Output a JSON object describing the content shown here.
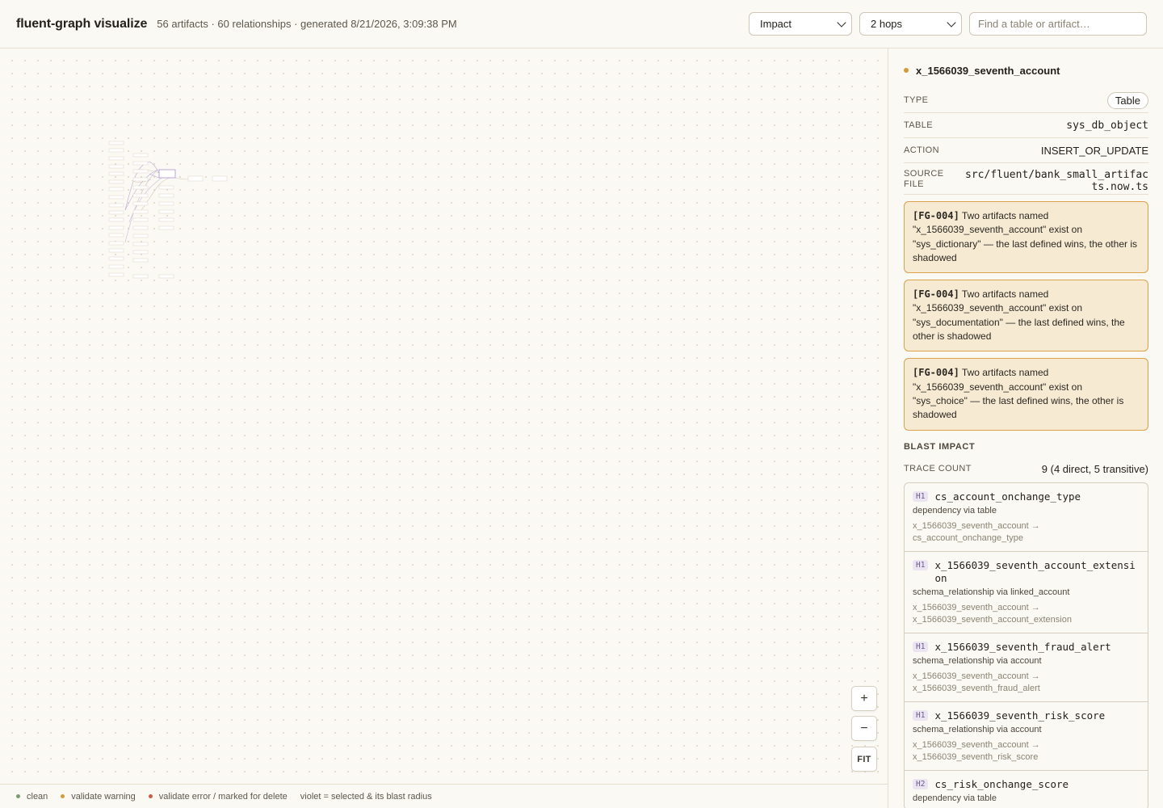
{
  "header": {
    "title": "fluent-graph visualize",
    "meta": "56 artifacts · 60 relationships · generated 8/21/2026, 3:09:38 PM",
    "view_select": "Impact",
    "hops_select": "2 hops",
    "search_placeholder": "Find a table or artifact…"
  },
  "canvas": {
    "zoom_in": "+",
    "zoom_out": "−",
    "fit": "FIT"
  },
  "legend": {
    "items": [
      {
        "label": "clean",
        "color": "#7d9b73"
      },
      {
        "label": "validate warning",
        "color": "#d39a3a"
      },
      {
        "label": "validate error / marked for delete",
        "color": "#d05a48"
      }
    ],
    "note": "violet = selected & its blast radius"
  },
  "panel": {
    "title": "x_1566039_seventh_account",
    "status_color": "#d39a3a",
    "props": {
      "type_label": "TYPE",
      "type_value": "Table",
      "table_label": "TABLE",
      "table_value": "sys_db_object",
      "action_label": "ACTION",
      "action_value": "INSERT_OR_UPDATE",
      "source_label": "SOURCE FILE",
      "source_value": "src/fluent/bank_small_artifacts.now.ts"
    },
    "warnings": [
      {
        "code": "[FG-004]",
        "text": " Two artifacts named \"x_1566039_seventh_account\" exist on \"sys_dictionary\" — the last defined wins, the other is shadowed"
      },
      {
        "code": "[FG-004]",
        "text": " Two artifacts named \"x_1566039_seventh_account\" exist on \"sys_documentation\" — the last defined wins, the other is shadowed"
      },
      {
        "code": "[FG-004]",
        "text": " Two artifacts named \"x_1566039_seventh_account\" exist on \"sys_choice\" — the last defined wins, the other is shadowed"
      }
    ],
    "blast_heading": "BLAST IMPACT",
    "trace_label": "TRACE COUNT",
    "trace_value": "9 (4 direct, 5 transitive)",
    "traces": [
      {
        "hop": "H1",
        "name": "cs_account_onchange_type",
        "rel": "dependency via table",
        "path": "x_1566039_seventh_account → cs_account_onchange_type"
      },
      {
        "hop": "H1",
        "name": "x_1566039_seventh_account_extension",
        "rel": "schema_relationship via linked_account",
        "path": "x_1566039_seventh_account → x_1566039_seventh_account_extension"
      },
      {
        "hop": "H1",
        "name": "x_1566039_seventh_fraud_alert",
        "rel": "schema_relationship via account",
        "path": "x_1566039_seventh_account → x_1566039_seventh_fraud_alert"
      },
      {
        "hop": "H1",
        "name": "x_1566039_seventh_risk_score",
        "rel": "schema_relationship via account",
        "path": "x_1566039_seventh_account → x_1566039_seventh_risk_score"
      },
      {
        "hop": "H2",
        "name": "cs_risk_onchange_score",
        "rel": "dependency via table",
        "path": ""
      }
    ]
  }
}
